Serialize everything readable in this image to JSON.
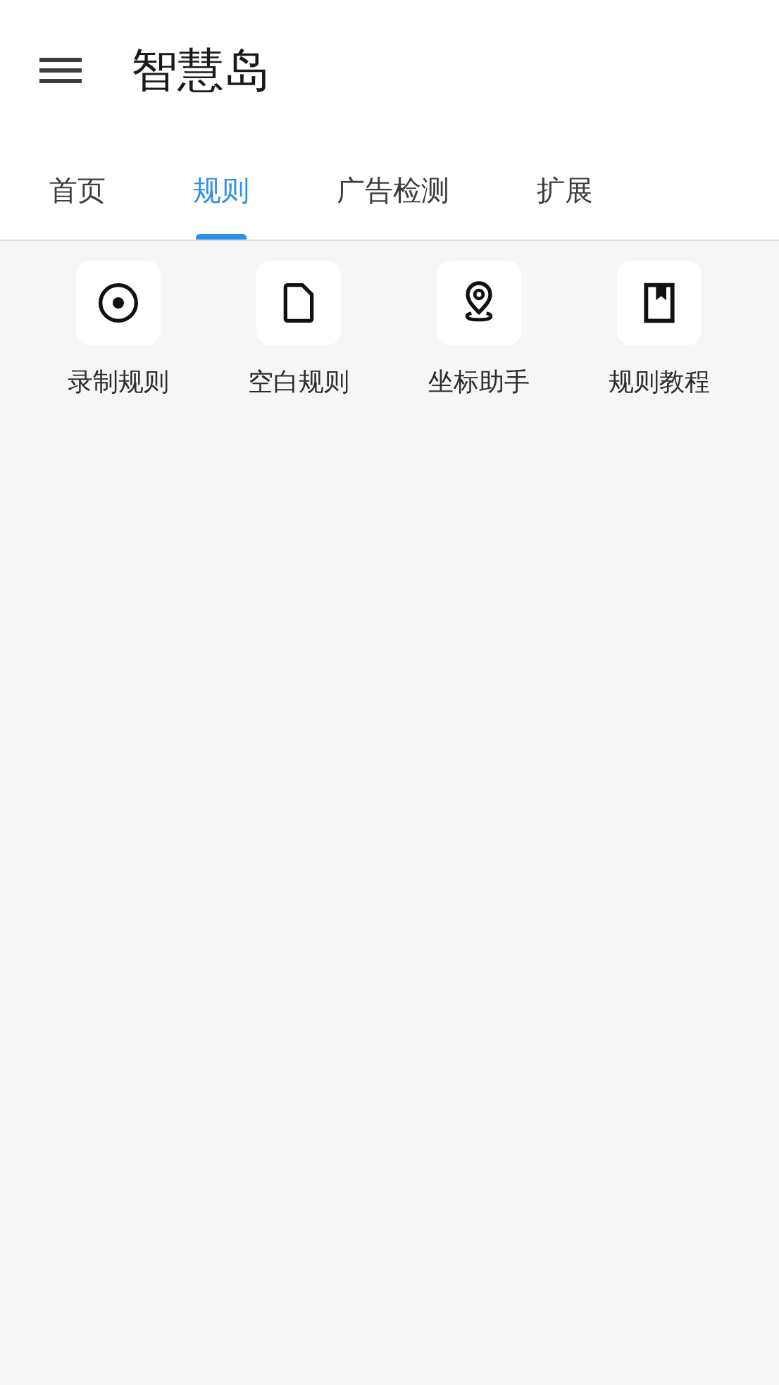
{
  "app_bar": {
    "title": "智慧岛"
  },
  "tabs": [
    {
      "label": "首页",
      "selected": false
    },
    {
      "label": "规则",
      "selected": true
    },
    {
      "label": "广告检测",
      "selected": false
    },
    {
      "label": "扩展",
      "selected": false
    }
  ],
  "actions": [
    {
      "kind": "record",
      "label": "录制规则"
    },
    {
      "kind": "file",
      "label": "空白规则"
    },
    {
      "kind": "pin",
      "label": "坐标助手"
    },
    {
      "kind": "book",
      "label": "规则教程"
    }
  ]
}
